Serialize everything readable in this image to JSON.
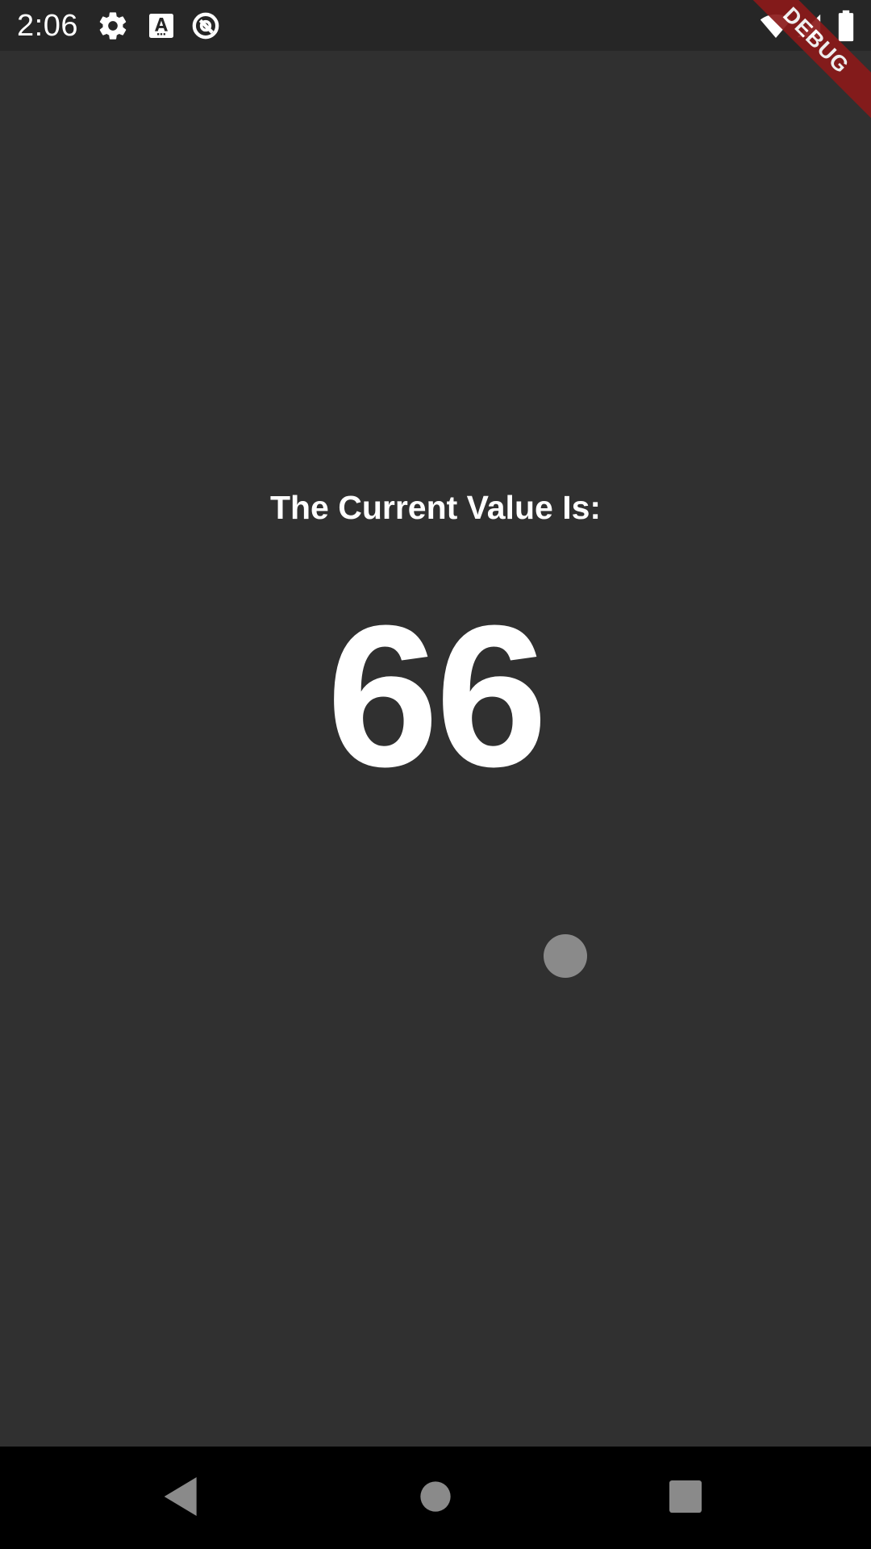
{
  "status_bar": {
    "time": "2:06",
    "icons": [
      "gear-icon",
      "font-icon",
      "sync-icon",
      "wifi-icon",
      "signal-icon",
      "battery-icon"
    ]
  },
  "debug_banner": {
    "label": "DEBUG",
    "color": "#8b1a1a"
  },
  "main": {
    "label": "The Current Value Is:",
    "value": "66"
  },
  "slider": {
    "value": 66,
    "thumb_color": "#8a8a8a"
  },
  "nav_bar": {
    "buttons": [
      "back-icon",
      "home-icon",
      "recents-icon"
    ]
  },
  "colors": {
    "background": "#303030",
    "status_bar": "#262626",
    "nav_bar": "#000000",
    "text": "#ffffff"
  }
}
